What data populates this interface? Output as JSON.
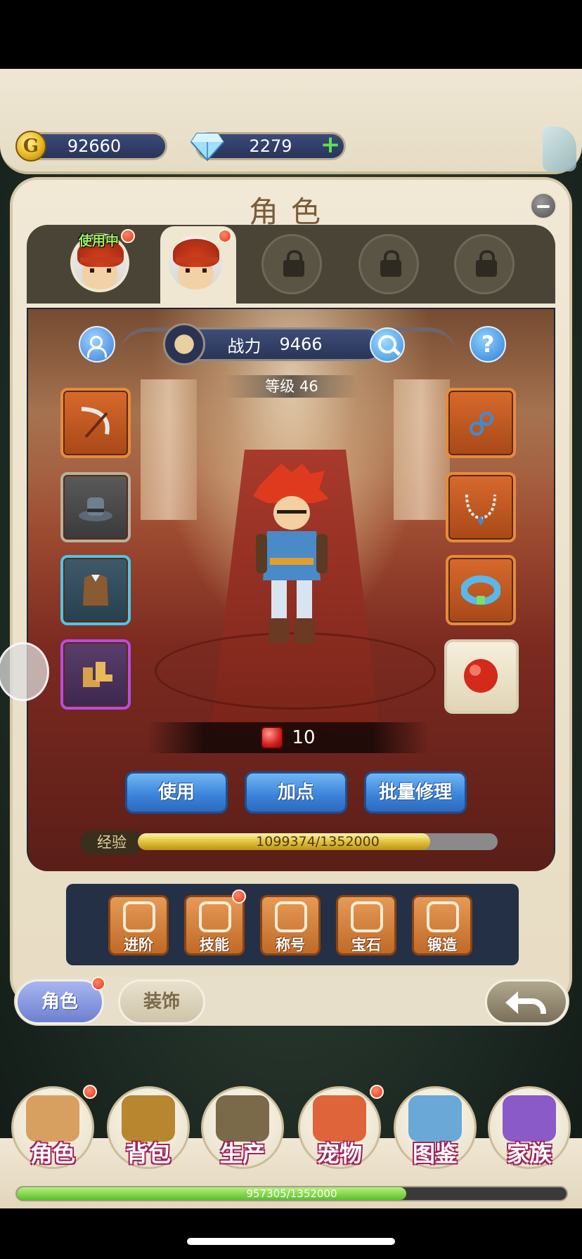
{
  "currency": {
    "gold": "92660",
    "gems": "2279",
    "gold_icon": "G"
  },
  "panel": {
    "title": "角色",
    "in_use_label": "使用中"
  },
  "combat": {
    "power_label": "战力",
    "power_value": "9466",
    "level_text": "等级 46",
    "help_glyph": "?"
  },
  "inventory": {
    "gem_count": "10"
  },
  "actions": {
    "use": "使用",
    "add_points": "加点",
    "batch_repair": "批量修理"
  },
  "exp": {
    "label": "经验",
    "text": "1099374/1352000",
    "fraction": 0.813
  },
  "functions": [
    {
      "label": "进阶",
      "icon": "advance-icon"
    },
    {
      "label": "技能",
      "icon": "skill-icon"
    },
    {
      "label": "称号",
      "icon": "title-icon"
    },
    {
      "label": "宝石",
      "icon": "gem-icon"
    },
    {
      "label": "锻造",
      "icon": "forge-hammer-icon"
    }
  ],
  "tabs": {
    "role": "角色",
    "decoration": "装饰"
  },
  "nav": [
    {
      "label": "角色",
      "icon": "hero-icon",
      "color": "#d8a060"
    },
    {
      "label": "背包",
      "icon": "backpack-icon",
      "color": "#b8862e"
    },
    {
      "label": "生产",
      "icon": "pickaxe-icon",
      "color": "#7a6a4a"
    },
    {
      "label": "宠物",
      "icon": "pet-icon",
      "color": "#e0643a"
    },
    {
      "label": "图鉴",
      "icon": "book-icon",
      "color": "#6aa8d8"
    },
    {
      "label": "家族",
      "icon": "guild-banner-icon",
      "color": "#8a5ac8"
    }
  ],
  "bottom_exp": {
    "text": "957305/1352000",
    "fraction": 0.708
  },
  "colors": {
    "accent_blue": "#3a82d8",
    "slot_orange": "#d86a2c",
    "exp_gold": "#e3c23a",
    "exp_green": "#58c22a"
  }
}
